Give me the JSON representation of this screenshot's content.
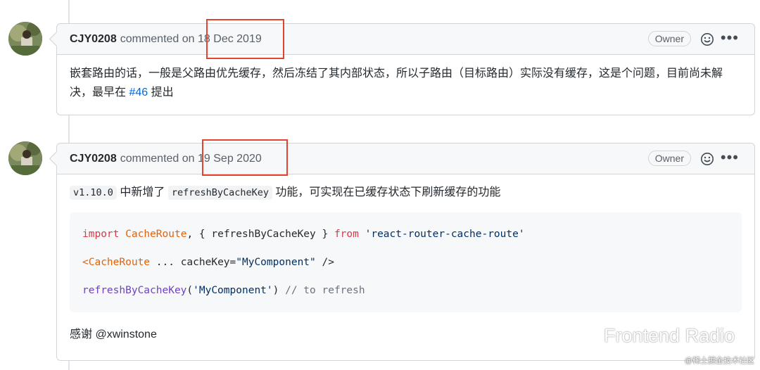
{
  "comments": [
    {
      "author": "CJY0208",
      "action": "commented on",
      "date": "18 Dec 2019",
      "badge": "Owner",
      "body_part1": "嵌套路由的话，一般是父路由优先缓存，然后冻结了其内部状态，所以子路由（目标路由）实际没有缓存，这是个问题，目前尚未解决，最早在 ",
      "issue_link": "#46",
      "body_part2": " 提出"
    },
    {
      "author": "CJY0208",
      "action": "commented on",
      "date": "19 Sep 2020",
      "badge": "Owner",
      "version_code": "v1.10.0",
      "text_1": " 中新增了 ",
      "feature_code": "refreshByCacheKey",
      "text_2": " 功能，可实现在已缓存状态下刷新缓存的功能",
      "code": {
        "l1_import": "import",
        "l1_cacheroute": "CacheRoute",
        "l1_mid": ", { refreshByCacheKey } ",
        "l1_from": "from",
        "l1_module": "'react-router-cache-route'",
        "l2_open": "<",
        "l2_tag": "CacheRoute",
        "l2_attr": " ... cacheKey=",
        "l2_value": "\"MyComponent\"",
        "l2_close": " />",
        "l3_fn": "refreshByCacheKey",
        "l3_open": "(",
        "l3_arg": "'MyComponent'",
        "l3_close": ")",
        "l3_comment": " // to refresh"
      },
      "thanks": "感谢 @xwinstone"
    }
  ],
  "watermark": "Frontend Radio",
  "watermark_sub": "@稀土掘金技术社区",
  "colors": {
    "highlight_box": "#e2442f",
    "link": "#0366d6"
  }
}
